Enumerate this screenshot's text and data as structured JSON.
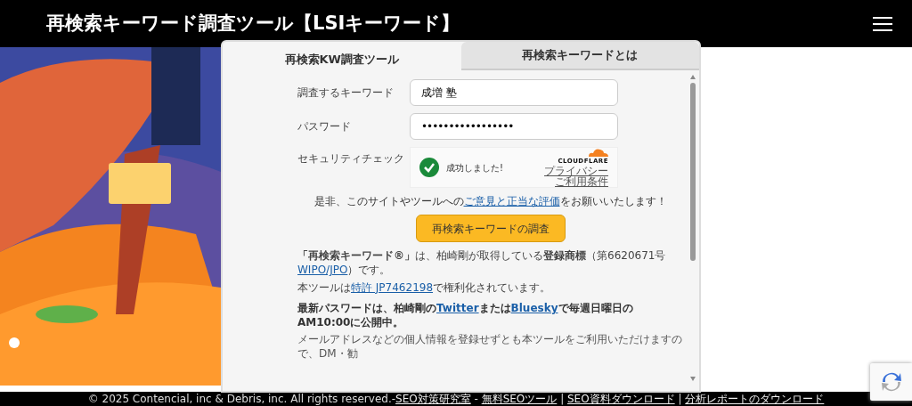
{
  "header": {
    "title": "再検索キーワード調査ツール【LSIキーワード】"
  },
  "tabs": [
    {
      "label": "再検索KW調査ツール",
      "selected": true
    },
    {
      "label": "再検索キーワードとは",
      "selected": false
    }
  ],
  "fields": [
    {
      "label": "調査するキーワード",
      "kind": "text",
      "value": "成増 塾"
    },
    {
      "label": "パスワード",
      "kind": "password",
      "value": "•••••••••••••••••"
    }
  ],
  "security": {
    "label": "セキュリティチェック",
    "status": "成功しました!",
    "verified": true,
    "brand": "CLOUDFLARE",
    "links": [
      "プライバシー",
      "ご利用条件"
    ]
  },
  "request": [
    {
      "text": "是非、このサイトやツールへの",
      "link": false
    },
    {
      "text": "ご意見と正当な評価",
      "link": true
    },
    {
      "text": "をお願いいたします！",
      "link": false
    }
  ],
  "submit_button": "再検索キーワードの調査",
  "notes": [
    [
      {
        "text": "**「再検索キーワード®」**は、柏崎剛が取得している**登録商標**（第6620671号 ",
        "link": false
      },
      {
        "text": "WIPO/JPO",
        "link": true
      },
      {
        "text": "）です。",
        "link": false
      }
    ],
    [
      {
        "text": "本ツールは",
        "link": false
      },
      {
        "text": "特許 JP7462198",
        "link": true
      },
      {
        "text": "で権利化されています。",
        "link": false
      }
    ]
  ],
  "announcement": [
    {
      "text": "最新パスワードは、柏崎剛の",
      "link": false
    },
    {
      "text": "Twitter",
      "link": true
    },
    {
      "text": "または",
      "link": false
    },
    {
      "text": "Bluesky",
      "link": true
    },
    {
      "text": "で毎週日曜日のAM10:00に公開中。",
      "link": false
    }
  ],
  "partial_text": "メールアドレスなどの個人情報を登録せずとも本ツールをご利用いただけますので、DM・勧",
  "footer": [
    {
      "text": "© 2025 Contencial, inc & Debris, inc. All rights reserved.-",
      "link": false
    },
    {
      "text": "SEO対策研究室",
      "link": true
    },
    {
      "text": " - ",
      "link": false
    },
    {
      "text": "無料SEOツール",
      "link": true
    },
    {
      "text": " | ",
      "link": false
    },
    {
      "text": "SEO資料ダウンロード",
      "link": true
    },
    {
      "text": " | ",
      "link": false
    },
    {
      "text": "分析レポートのダウンロード",
      "link": true
    }
  ]
}
